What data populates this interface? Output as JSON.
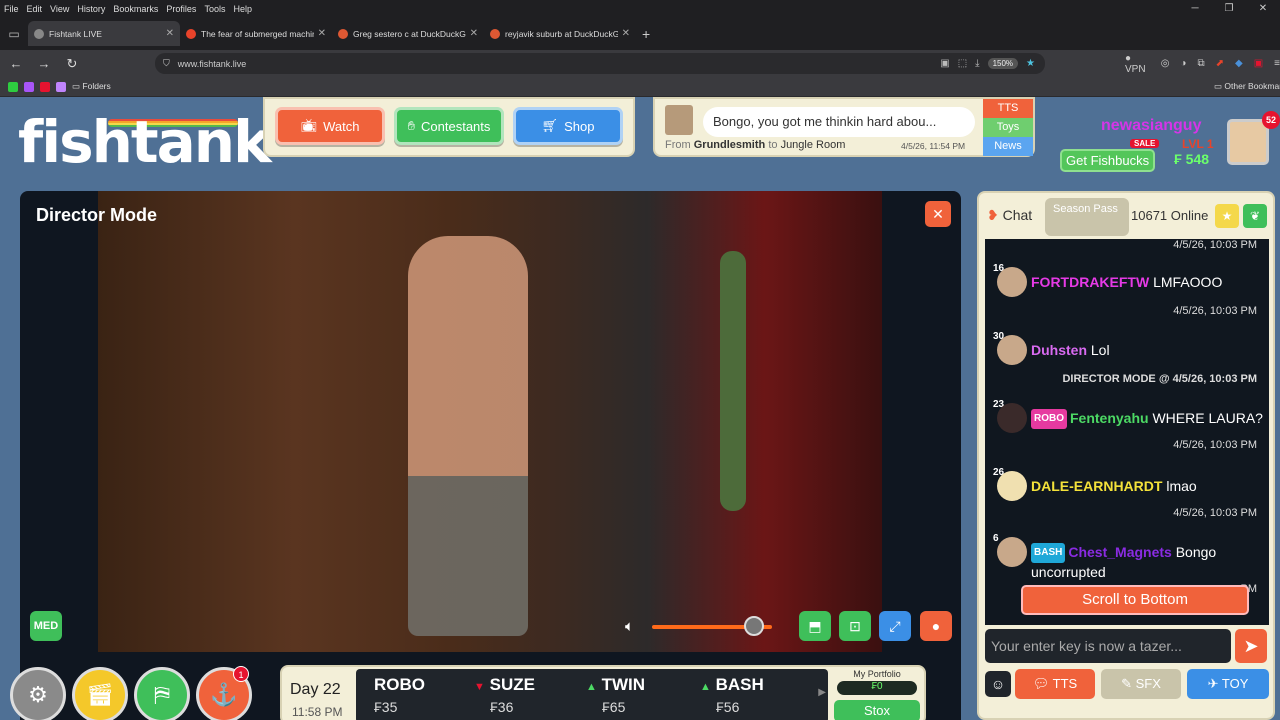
{
  "browser": {
    "menu": [
      "File",
      "Edit",
      "View",
      "History",
      "Bookmarks",
      "Profiles",
      "Tools",
      "Help"
    ],
    "tabs": [
      {
        "title": "Fishtank LIVE",
        "active": true,
        "color": "#888888"
      },
      {
        "title": "The fear of submerged machine",
        "active": false,
        "color": "#e8432a"
      },
      {
        "title": "Greg sestero c at DuckDuckGo",
        "active": false,
        "color": "#de5833"
      },
      {
        "title": "reyjavik suburb at DuckDuckGo",
        "active": false,
        "color": "#de5833"
      }
    ],
    "url": "www.fishtank.live",
    "zoom": "150%",
    "vpn": "VPN",
    "bookmarks_folder": "Folders",
    "other_bookmarks": "Other Bookmarks"
  },
  "header": {
    "logo": "fishtank",
    "logo_mark": "©",
    "nav": {
      "watch": "Watch",
      "contestants": "Contestants",
      "shop": "Shop"
    },
    "tts": {
      "message": "Bongo, you got me thinkin hard abou...",
      "from_label": "From",
      "from_user": "Grundlesmith",
      "to_label": "to",
      "room": "Jungle Room",
      "time": "4/5/26, 11:54 PM",
      "tabs": [
        "TTS",
        "Toys",
        "News"
      ]
    },
    "user": {
      "name": "newasianguy",
      "sale": "SALE",
      "level": "LVL 1",
      "get_fishbucks": "Get Fishbucks",
      "fishbucks": "₣ 548",
      "notifications": "52"
    }
  },
  "video": {
    "title": "Director Mode",
    "close": "✕",
    "quality": "MED",
    "volume": 0.85
  },
  "bottom": {
    "badge": "1",
    "day": "Day 22",
    "time": "11:58 PM",
    "stocks": [
      {
        "name": "ROBO",
        "price": "₣35",
        "dir": ""
      },
      {
        "name": "SUZE",
        "price": "₣36",
        "dir": "down"
      },
      {
        "name": "TWIN",
        "price": "₣65",
        "dir": "up"
      },
      {
        "name": "BASH",
        "price": "₣56",
        "dir": "up"
      }
    ],
    "portfolio_title": "My Portfolio",
    "portfolio_value": "₣0",
    "stox": "Stox"
  },
  "chat": {
    "label": "Chat",
    "season_pass": "Season Pass",
    "online": "10671 Online",
    "top_time": "4/5/26, 10:03 PM",
    "messages": [
      {
        "level": "16",
        "user": "FORTDRAKEFTW",
        "color": "#e63ae6",
        "tag": "",
        "tag_color": "",
        "text": "LMFAOOO",
        "time": "4/5/26, 10:03 PM"
      },
      {
        "level": "30",
        "user": "Duhsten",
        "color": "#d86af0",
        "tag": "",
        "tag_color": "",
        "text": "Lol",
        "time": "DIRECTOR MODE @ 4/5/26, 10:03 PM"
      },
      {
        "level": "23",
        "user": "Fentenyahu",
        "color": "#4cd964",
        "tag": "ROBO",
        "tag_color": "#e63aa0",
        "text": "WHERE LAURA?",
        "time": "4/5/26, 10:03 PM"
      },
      {
        "level": "26",
        "user": "DALE-EARNHARDT",
        "color": "#f4e23a",
        "tag": "",
        "tag_color": "",
        "text": "lmao",
        "time": "4/5/26, 10:03 PM"
      },
      {
        "level": "6",
        "user": "Chest_Magnets",
        "color": "#8a2be2",
        "tag": "BASH",
        "tag_color": "#1fa8d8",
        "text": "Bongo uncorrupted",
        "time": "PM"
      }
    ],
    "scroll_to_bottom": "Scroll to Bottom",
    "input_placeholder": "Your enter key is now a tazer...",
    "footer": {
      "tts": "TTS",
      "sfx": "SFX",
      "toy": "TOY"
    }
  }
}
